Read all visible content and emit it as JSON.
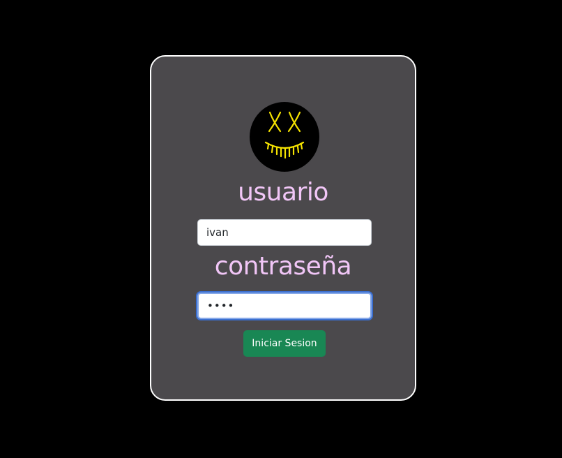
{
  "login": {
    "user_label": "usuario",
    "user_value": "ivan",
    "pass_label": "contraseña",
    "pass_value": "••••",
    "submit_label": "Iniciar Sesion"
  },
  "avatar": {
    "icon": "glowing-mask-icon"
  },
  "colors": {
    "page_background": "#000000",
    "card_background": "#4b494c",
    "card_border": "#ffffff",
    "label_text": "#f1c6f7",
    "button_background": "#198754",
    "focus_ring": "#3b6fd0",
    "mask_glow": "#f5e300"
  }
}
